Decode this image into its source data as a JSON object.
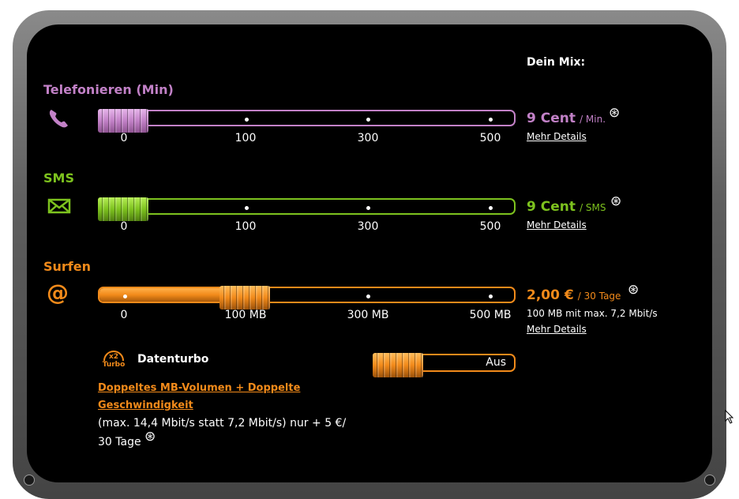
{
  "mix_heading": "Dein Mix:",
  "colors": {
    "phone": "#c281c7",
    "sms": "#7dc21e",
    "surf": "#f28a1a",
    "text": "#ffffff"
  },
  "sections": {
    "phone": {
      "title": "Telefonieren (Min)",
      "icon": "phone-icon",
      "ticks": [
        "0",
        "100",
        "300",
        "500"
      ],
      "selected_index": 0,
      "price": "9 Cent",
      "price_unit": "/ Min.",
      "footnote": "⊛",
      "details": "Mehr Details"
    },
    "sms": {
      "title": "SMS",
      "icon": "envelope-icon",
      "ticks": [
        "0",
        "100",
        "300",
        "500"
      ],
      "selected_index": 0,
      "price": "9 Cent",
      "price_unit": "/ SMS",
      "footnote": "⊛",
      "details": "Mehr Details"
    },
    "surf": {
      "title": "Surfen",
      "icon": "at-icon",
      "ticks": [
        "0",
        "100 MB",
        "300 MB",
        "500 MB"
      ],
      "selected_index": 1,
      "price": "2,00 €",
      "price_unit": "/ 30 Tage",
      "footnote": "⊛",
      "sub": "100 MB mit max. 7,2 Mbit/s",
      "details": "Mehr Details"
    }
  },
  "turbo": {
    "badge_top": "x2",
    "badge_bottom": "Turbo",
    "title": "Datenturbo",
    "link_line1": "Doppeltes MB-Volumen + Doppelte",
    "link_line2": "Geschwindigkeit",
    "desc_line1": "(max. 14,4 Mbit/s statt 7,2 Mbit/s) nur + 5 €/",
    "desc_line2": "30 Tage",
    "footnote": "⊛",
    "toggle_value": "Aus"
  }
}
